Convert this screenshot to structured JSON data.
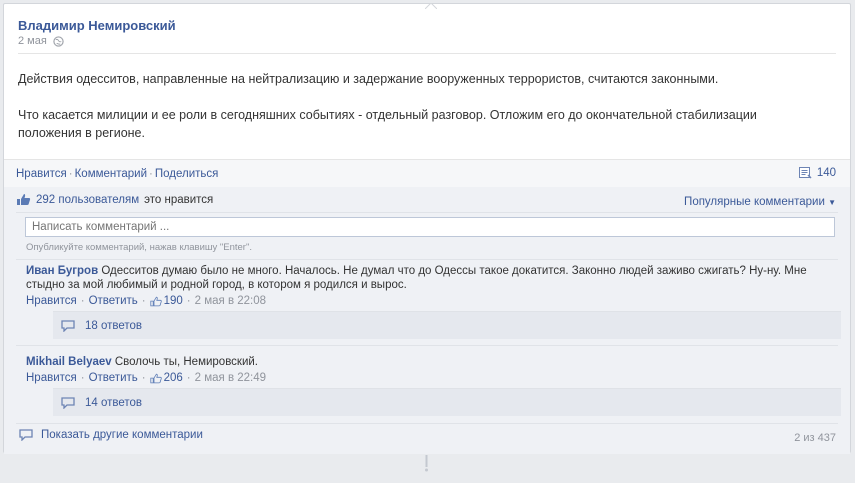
{
  "post": {
    "author": "Владимир Немировский",
    "date": "2 мая",
    "paragraphs": [
      "Действия одесситов, направленные на нейтрализацию и задержание вооруженных террористов, считаются законными.",
      "Что касается милиции и ее роли в сегодняшних событиях - отдельный разговор. Отложим его до окончательной стабилизации положения в регионе."
    ]
  },
  "actions": {
    "like": "Нравится",
    "comment": "Комментарий",
    "share": "Поделиться",
    "shares_count": "140"
  },
  "likes": {
    "count_text": "292 пользователям",
    "suffix": "это нравится",
    "sort": "Популярные комментарии"
  },
  "comment_box": {
    "placeholder": "Написать комментарий ...",
    "hint": "Опубликуйте комментарий, нажав клавишу \"Enter\"."
  },
  "comments": [
    {
      "author": "Иван Бугров",
      "text": "Одесситов думаю было не много. Началось. Не думал что до Одессы такое докатится. Законно людей заживо сжигать? Ну-ну. Мне стыдно за мой любимый и родной город, в котором я родился и вырос.",
      "like": "Нравится",
      "reply": "Ответить",
      "likes": "190",
      "time": "2 мая в 22:08",
      "replies": "18 ответов"
    },
    {
      "author": "Mikhail Belyaev",
      "text": "Сволочь ты, Немировский.",
      "like": "Нравится",
      "reply": "Ответить",
      "likes": "206",
      "time": "2 мая в 22:49",
      "replies": "14 ответов"
    }
  ],
  "footer": {
    "more": "Показать другие комментарии",
    "count": "2 из 437"
  },
  "icons": {
    "globe": "globe-icon",
    "shares": "shares-icon",
    "like": "thumbs-up-icon",
    "reply": "speech-bubble-icon"
  },
  "colors": {
    "link": "#3b5998",
    "muted": "#90949c",
    "comments_bg": "#eff1f5"
  }
}
